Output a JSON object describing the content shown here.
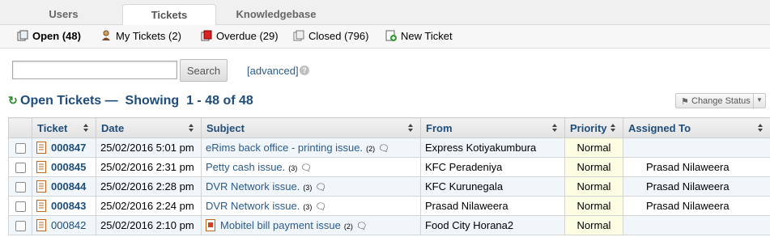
{
  "tabs": [
    {
      "label": "Users",
      "active": false
    },
    {
      "label": "Tickets",
      "active": true
    },
    {
      "label": "Knowledgebase",
      "active": false
    }
  ],
  "subnav": [
    {
      "label": "Open (48)",
      "icon": "open-tickets-icon",
      "current": true
    },
    {
      "label": "My Tickets (2)",
      "icon": "user-icon",
      "current": false
    },
    {
      "label": "Overdue (29)",
      "icon": "overdue-icon",
      "current": false
    },
    {
      "label": "Closed (796)",
      "icon": "closed-tickets-icon",
      "current": false
    },
    {
      "label": "New Ticket",
      "icon": "new-ticket-icon",
      "current": false
    }
  ],
  "search": {
    "value": "",
    "button_label": "Search",
    "advanced_label": "[advanced]"
  },
  "heading": {
    "title": "Open Tickets —",
    "showing": "Showing",
    "range": "1 - 48 of 48"
  },
  "change_status": {
    "label": "Change Status"
  },
  "table": {
    "columns": [
      "Ticket",
      "Date",
      "Subject",
      "From",
      "Priority",
      "Assigned To"
    ],
    "rows": [
      {
        "ticket": "000847",
        "date": "25/02/2016 5:01 pm",
        "subject": "eRims back office - printing issue.",
        "count": "(2)",
        "from": "Express Kotiyakumbura",
        "priority": "Normal",
        "assigned": "",
        "bold": true
      },
      {
        "ticket": "000845",
        "date": "25/02/2016 2:31 pm",
        "subject": "Petty cash issue.",
        "count": "(3)",
        "from": "KFC Peradeniya",
        "priority": "Normal",
        "assigned": "Prasad Nilaweera",
        "bold": true
      },
      {
        "ticket": "000844",
        "date": "25/02/2016 2:28 pm",
        "subject": "DVR Network issue.",
        "count": "(3)",
        "from": "KFC Kurunegala",
        "priority": "Normal",
        "assigned": "Prasad Nilaweera",
        "bold": true
      },
      {
        "ticket": "000843",
        "date": "25/02/2016 2:24 pm",
        "subject": "DVR Network issue.",
        "count": "(3)",
        "from": "Prasad Nilaweera",
        "priority": "Normal",
        "assigned": "Prasad Nilaweera",
        "bold": true
      },
      {
        "ticket": "000842",
        "date": "25/02/2016 2:10 pm",
        "subject": "Mobitel bill payment issue",
        "count": "(2)",
        "from": "Food City Horana2",
        "priority": "Normal",
        "assigned": "",
        "bold": false
      }
    ]
  },
  "colors": {
    "link": "#2a5b8c",
    "heading": "#1e4d7b",
    "row_alt": "#f1f6fb",
    "priority_bg": "#fdfde3",
    "refresh": "#2e8b2e"
  }
}
